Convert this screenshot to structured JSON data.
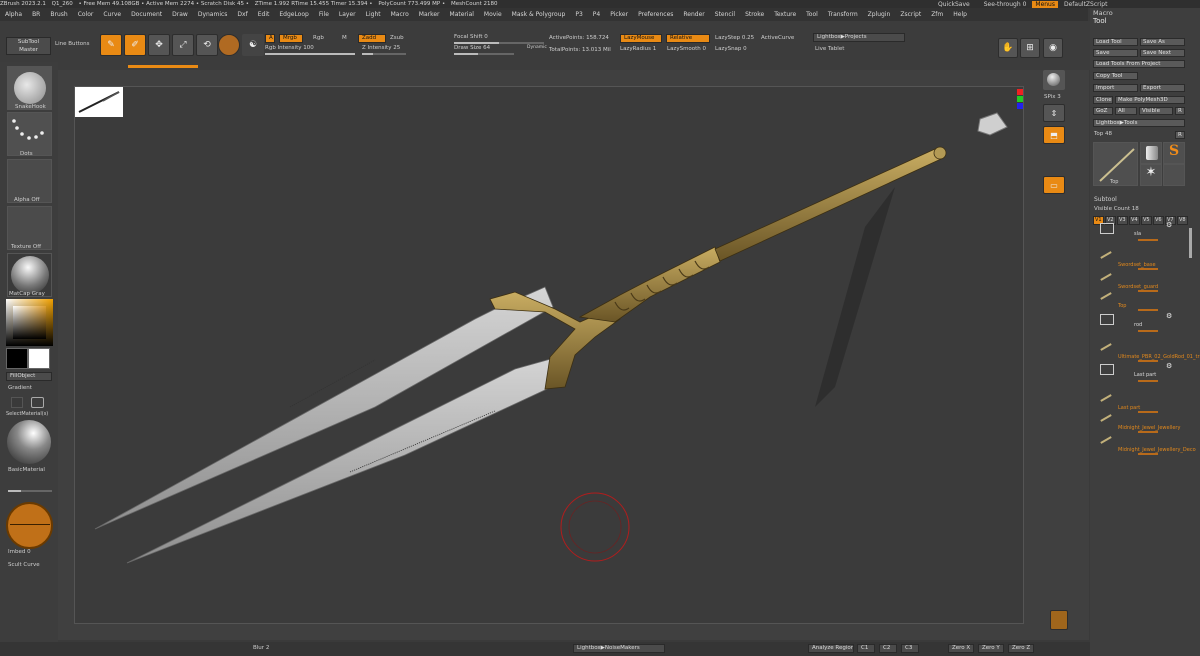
{
  "titlebar": {
    "items": [
      "ZBrush 2023.2.1",
      "Q1_260",
      "• Free Mem 49.108GB • Active Mem 2274 • Scratch Disk 45 •",
      "ZTime 1.992 RTime 15.455 Timer 15.394 •",
      "PolyCount 773.499 MP •",
      "MeshCount 2180"
    ],
    "quicksave": "QuickSave",
    "see_through": "See-through",
    "see_through_val": "0",
    "menus": "Menus",
    "default_zscript": "DefaultZScript"
  },
  "menubar": [
    "Alpha",
    "BR",
    "Brush",
    "Color",
    "Curve",
    "Document",
    "Draw",
    "Dynamics",
    "Dxf",
    "Edit",
    "EdgeLoop",
    "File",
    "Layer",
    "Light",
    "Macro",
    "Marker",
    "Material",
    "Movie",
    "Mask & Polygroup",
    "P3",
    "P4",
    "Picker",
    "Preferences",
    "Render",
    "Stencil",
    "Stroke",
    "Texture",
    "Tool",
    "Transform",
    "Zplugin",
    "Zscript",
    "Zfm",
    "Help"
  ],
  "toolbar": {
    "subtool_master": "SubTool Master",
    "line_buttons": "Line Buttons",
    "edit": "Edit",
    "draw": "Draw",
    "move": "Move",
    "scale": "Scale",
    "rotate": "Rotate",
    "a_label": "A",
    "mrgb": "Mrgb",
    "rgb": "Rgb",
    "m": "M",
    "zadd": "Zadd",
    "zsub": "Zsub",
    "rgb_intensity": "Rgb Intensity 100",
    "z_intensity": "Z Intensity 25",
    "focal_shift": "Focal Shift 0",
    "draw_size": "Draw Size 64",
    "dynamic": "Dynamic",
    "active_points": "ActivePoints: 158.724",
    "total_points": "TotalPoints: 13.013 Mil",
    "lazymouse": "LazyMouse",
    "relative": "Relative",
    "lazystep": "LazyStep 0.25",
    "lazyradius": "LazyRadius 1",
    "lazysmooth": "LazySmooth 0",
    "lazysnap": "LazySnap 0",
    "active_curve": "ActiveCurve",
    "lightbox_projects": "Lightbox▶Projects",
    "live_tablet": "Live Tablet"
  },
  "left_shelf": {
    "brush_label": "SnakeHook",
    "stroke_label": "Dots",
    "alpha_label": "Alpha Off",
    "texture_label": "Texture Off",
    "material_label": "MatCap Gray",
    "fill_object": "FillObject",
    "gradient": "Gradient",
    "switch_color": "SwitchColor",
    "switch_material": "SelectMaterial(s)",
    "basic_material": "BasicMaterial",
    "imbed": "Imbed",
    "imbed_val": "0",
    "zadd_sculpt": "Scult Curve"
  },
  "right_dock": {
    "bpr": "BPR",
    "spix": "SPix 3",
    "scroll": "Scroll",
    "zoom": "Zoom",
    "actual": "Actual",
    "persp": "Persp",
    "floor": "Floor",
    "move": "Move",
    "zoom3d": "Zoom3D",
    "rotate": "Rotate",
    "transp": "Transp"
  },
  "tool_panel": {
    "macro": "Macro",
    "tool": "Tool",
    "load_tool": "Load Tool",
    "save_as": "Save As",
    "save": "Save",
    "save_next": "Save Next",
    "load_tools_from_project": "Load Tools From Project",
    "copy_tool": "Copy Tool",
    "import": "Import",
    "export": "Export",
    "clone": "Clone",
    "make_polymesh": "Make PolyMesh3D",
    "goz": "GoZ",
    "all": "All",
    "visible": "Visible",
    "r": "R",
    "lightbox_tools": "Lightbox▶Tools",
    "top": "Top",
    "top_val": "48",
    "thumbs": [
      "Top",
      "Cylinder3D",
      "SimpleBrush",
      "PolyMesh3D",
      "Star",
      "Top"
    ],
    "subtool": "Subtool",
    "visible_count": "Visible Count 18",
    "v_tabs": [
      "V1",
      "V2",
      "V3",
      "V4",
      "V5",
      "V6",
      "V7",
      "V8"
    ],
    "subtools": [
      {
        "name": "sla",
        "folder": true
      },
      {
        "name": "Swordset_base",
        "folder": false
      },
      {
        "name": "Swordset_guard",
        "folder": false
      },
      {
        "name": "Top",
        "folder": false
      },
      {
        "name": "rod",
        "folder": true
      },
      {
        "name": "Ultimate_PBR_02_GoldRod_01_tri",
        "folder": false
      },
      {
        "name": "Last part",
        "folder": true
      },
      {
        "name": "Last part",
        "folder": false
      },
      {
        "name": "Midnight_Jewel_Jewellery",
        "folder": false
      },
      {
        "name": "Midnight_Jewel_Jewellery_Deco",
        "folder": false
      }
    ]
  },
  "bottombar": {
    "blur": "Blur",
    "blur_val": "2",
    "lightbox_noisemakers": "Lightbox▶NoiseMakers",
    "analyze_region": "Analyze Region",
    "c1": "C1",
    "c2": "C2",
    "c3": "C3",
    "zero_x": "Zero X",
    "zero_y": "Zero Y",
    "zero_z": "Zero Z"
  },
  "colors": {
    "accent": "#e98a14",
    "gold": "#a78b45",
    "blade": "#b9b9b9",
    "background": "#3b3b3b"
  }
}
